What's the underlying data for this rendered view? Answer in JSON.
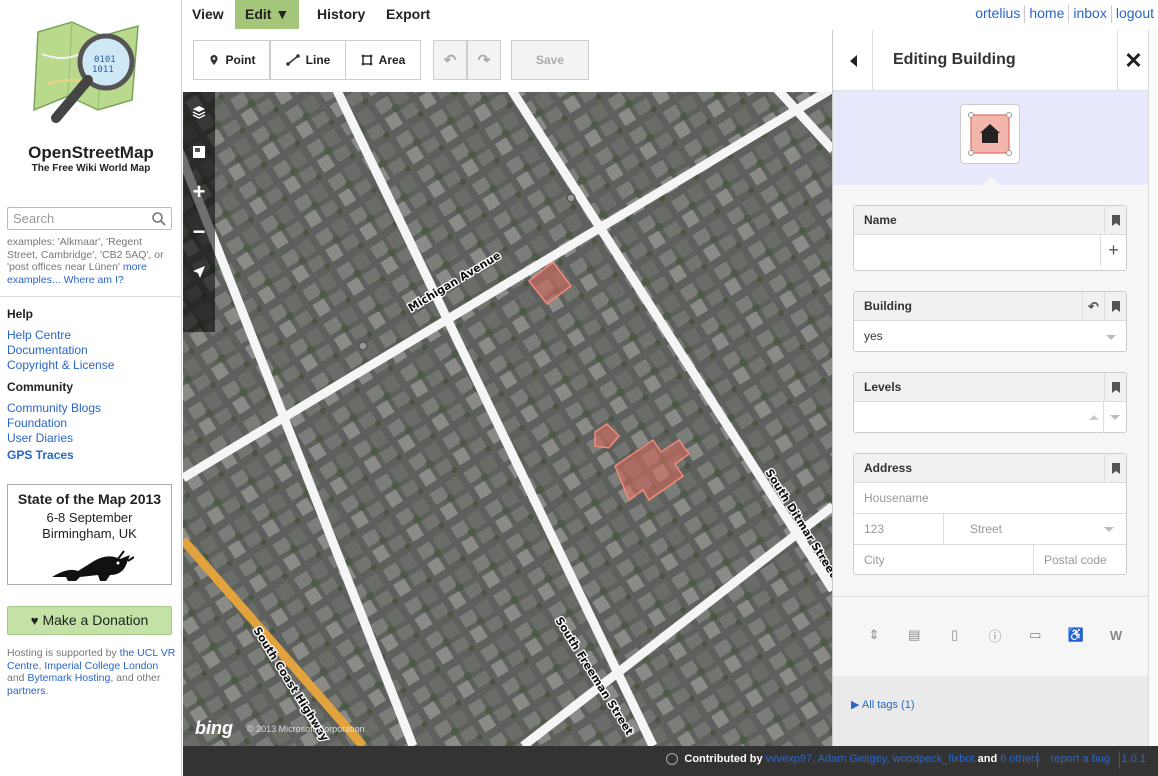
{
  "sidebar": {
    "brand_title": "OpenStreetMap",
    "brand_subtitle": "The Free Wiki World Map",
    "search": {
      "placeholder": "Search",
      "value": ""
    },
    "search_examples_prefix": "examples: 'Alkmaar', 'Regent Street, Cambridge', 'CB2 5AQ', or 'post offices near Lünen'",
    "search_examples_more": "more examples...",
    "where_am_i": "Where am I?",
    "help_heading": "Help",
    "help_links": [
      "Help Centre",
      "Documentation",
      "Copyright & License"
    ],
    "community_heading": "Community",
    "community_links": [
      "Community Blogs",
      "Foundation",
      "User Diaries",
      "GPS Traces"
    ],
    "sotm": {
      "title": "State of the Map 2013",
      "dates": "6-8 September",
      "place": "Birmingham, UK"
    },
    "donate_label": "Make a Donation",
    "hosting": {
      "prefix": "Hosting is supported by ",
      "ucl": "the UCL VR Centre",
      "sep1": ", ",
      "imperial": "Imperial College London",
      "and": " and ",
      "bytemark": "Bytemark Hosting",
      "tail": ", and other ",
      "partners": "partners",
      "end": "."
    }
  },
  "topbar": {
    "tabs": [
      "View",
      "Edit ▼",
      "History",
      "Export"
    ],
    "user_links": [
      "ortelius",
      "home",
      "inbox",
      "logout"
    ]
  },
  "map": {
    "modes": [
      "Point",
      "Line",
      "Area"
    ],
    "save_label": "Save",
    "streets": [
      "Michigan Avenue",
      "South Ditmar Street",
      "South Freeman Street",
      "South Coast Highway"
    ],
    "imagery_brand": "bing",
    "imagery_copyright": "© 2013 Microsoft Corporation"
  },
  "panel": {
    "title": "Editing Building",
    "fields": {
      "name": {
        "label": "Name",
        "value": ""
      },
      "building": {
        "label": "Building",
        "value": "yes"
      },
      "levels": {
        "label": "Levels",
        "value": ""
      },
      "address": {
        "label": "Address",
        "housename": "Housename",
        "housenumber": "123",
        "street": "Street",
        "city": "City",
        "postcode": "Postal code"
      }
    },
    "all_tags": "All tags (1)"
  },
  "footer": {
    "contributed_by": "Contributed by",
    "contributors": "vvvexp97, Adam Geitgey, woodpeck_fixbot",
    "and": " and ",
    "others": "6 others",
    "report_bug": "report a bug",
    "version": "1.0.1"
  },
  "colors": {
    "accent_green": "#a3c67a",
    "link_blue": "#2a66c7",
    "panel_preset_bg": "#e6e9fc",
    "building_fill": "#e06e5f"
  }
}
